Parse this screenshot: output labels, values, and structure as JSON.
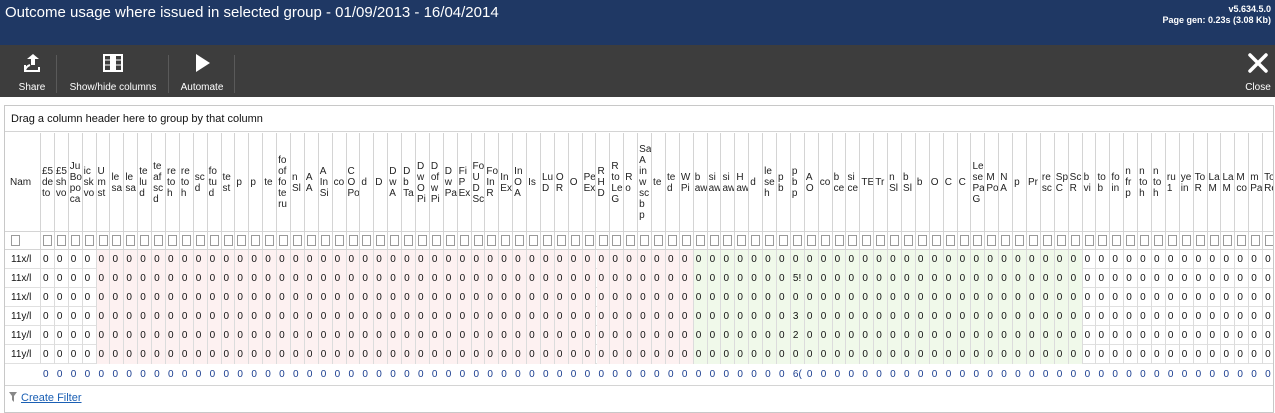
{
  "header": {
    "title": "Outcome usage where issued in selected group - 01/09/2013 - 16/04/2014",
    "version": "v5.634.5.0",
    "page_gen": "Page gen: 0.23s (3.08 Kb)"
  },
  "toolbar": {
    "share_label": "Share",
    "showhide_label": "Show/hide columns",
    "automate_label": "Automate",
    "close_label": "Close"
  },
  "grid": {
    "group_hint": "Drag a column header here to group by that column",
    "columns": [
      "Nam",
      "£5\nde\nto",
      "£5\nsh\nvo",
      "Ju\nBo\npo\nca",
      "ic\nsk\nvo",
      "U\nm\nst",
      "le\nsa",
      "le\nsa",
      "te\nlu\nd",
      "te\naf\nsc\nd",
      "re\nto\nh",
      "re\nto\nh",
      "sc\nd",
      "fo\ntu\nd",
      "te\nst",
      "p",
      "p",
      "te",
      "fo\nof\nfo\nte\nru",
      "n\nSl",
      "A\nA",
      "A\nIn\nSi",
      "co",
      "C\nO\nPo",
      "d",
      "D",
      "D\nw\nA",
      "D\nb\nTa",
      "D\nw\nO\nPi",
      "D\nof\nw\nPi",
      "D\nw\nPa",
      "Fi\nP\nEx",
      "Fo\nU\nD\nSc",
      "Fo\nIn\nR",
      "In\nEx",
      "In\nO\nA",
      "Is",
      "Lu\nD",
      "O\nR",
      "O",
      "Pe\nEx",
      "R\nH\nD",
      "R\nto\nLe\nG",
      "R\no",
      "Sa\nA\nin\nw\nsc\nb\np",
      "te",
      "te\nd",
      "W\nPi",
      "b\naw",
      "si\naw",
      "si\naw",
      "H\naw",
      "d",
      "le\nse\nh",
      "p\nb",
      "p\nb\np",
      "A\nO",
      "co",
      "b\nce",
      "si\nce",
      "TE",
      "Tr",
      "n\nSl",
      "b\nSl",
      "b",
      "O",
      "C",
      "C",
      "Le\nse\nPa\nG",
      "M\nPo",
      "N\nA",
      "p",
      "Pr",
      "re\nsc",
      "Sp\nC",
      "Sc\nR",
      "b\nvi",
      "to\nb",
      "fo\nin",
      "n\nfr\np",
      "n\nto\nh",
      "n\nto\nh",
      "ru\n1",
      "ye\nin",
      "To\nR",
      "La\nM",
      "La\nM",
      "M\nco",
      "m\nPa",
      "To\nRe"
    ],
    "rows": [
      {
        "name": "11x/l",
        "special": {}
      },
      {
        "name": "11x/l",
        "special": {
          "55": "5!"
        }
      },
      {
        "name": "11x/l",
        "special": {}
      },
      {
        "name": "11y/l",
        "special": {
          "55": "3"
        }
      },
      {
        "name": "11y/l",
        "special": {
          "55": "2"
        }
      },
      {
        "name": "11y/l",
        "special": {}
      }
    ],
    "default_value": "0",
    "totals_special": {
      "55": "6("
    },
    "create_filter": "Create Filter"
  },
  "colors": {
    "header_bg": "#1f3864",
    "toolbar_bg": "#3d3d3d",
    "pink_cell": "#fdf1f1",
    "green_cell": "#f0f9ea",
    "link": "#1a5fb4"
  },
  "icons": {
    "share": "share-icon",
    "showhide": "columns-icon",
    "automate": "play-icon",
    "close": "close-icon",
    "filter": "funnel-icon"
  }
}
